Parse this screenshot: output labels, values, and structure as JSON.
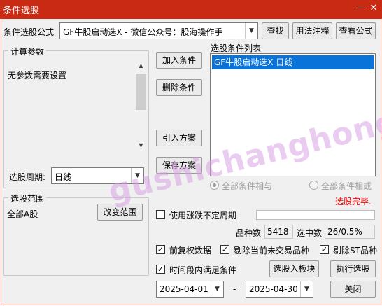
{
  "window": {
    "title": "条件选股",
    "minimize_glyph": "—",
    "close_glyph": "✕"
  },
  "formula": {
    "label": "条件选股公式",
    "selected": "GF牛股启动选X  -  微信公众号：股海操作手",
    "find_button": "查找",
    "usage_button": "用法注释",
    "view_button": "查看公式"
  },
  "params": {
    "group_title": "计算参数",
    "text": "无参数需要设置",
    "period_label": "选股周期:",
    "period_value": "日线"
  },
  "actions": {
    "add": "加入条件",
    "delete": "删除条件",
    "import": "引入方案",
    "save": "保存方案"
  },
  "conditions": {
    "title": "选股条件列表",
    "items": [
      "GF牛股启动选X  日线"
    ],
    "mode_and": "全部条件相与",
    "mode_or": "全部条件相或",
    "status": "选股完毕."
  },
  "scope": {
    "group_title": "选股范围",
    "value": "全部A股",
    "change_button": "改变范围"
  },
  "options": {
    "variable_period": "使用涨跌不定周期",
    "count_label": "品种数",
    "count_value": "5418",
    "selected_label": "选中数",
    "selected_value": "26/0.5%",
    "pre_adjust": "前复权数据",
    "exclude_untraded": "剔除当前未交易品种",
    "exclude_st": "剔除ST品种",
    "time_range": "时间段内满足条件"
  },
  "run": {
    "to_block": "选股入板块",
    "execute": "执行选股",
    "close": "关闭"
  },
  "dates": {
    "start": "2025-04-01",
    "separator": "-",
    "end": "2025-04-30"
  },
  "watermark": "gushichanghong.com",
  "colors": {
    "titlebar": "#c92a14",
    "selection": "#0a73d9",
    "status": "#ff0000"
  }
}
